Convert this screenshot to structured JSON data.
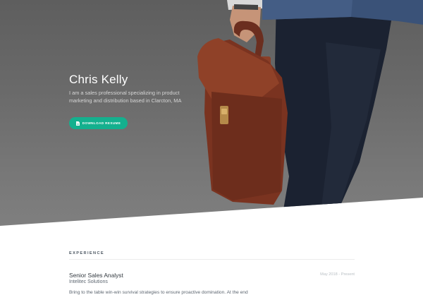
{
  "hero": {
    "name": "Chris Kelly",
    "bio": "I am a sales professional specializing in product marketing and distribution based in Clarcton, MA",
    "resume_button": {
      "label": "DOWNLOAD RESUME",
      "icon": "document-icon",
      "color": "#14b08e"
    }
  },
  "experience": {
    "heading": "EXPERIENCE",
    "jobs": [
      {
        "title": "Senior Sales Analyst",
        "company": "Intelitec Solutions",
        "dates": "May 2018 - Present",
        "description": "Bring to the table win-win survival strategies to ensure proactive domination. At the end"
      }
    ]
  }
}
